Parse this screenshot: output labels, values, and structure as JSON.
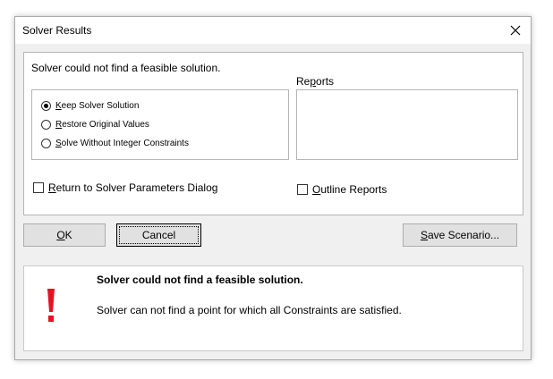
{
  "window": {
    "title": "Solver Results"
  },
  "group": {
    "message": "Solver could not find a feasible solution.",
    "options": [
      {
        "accel": "K",
        "rest": "eep Solver Solution",
        "checked": true
      },
      {
        "accel": "R",
        "rest": "estore Original Values",
        "checked": false
      },
      {
        "accel": "S",
        "rest": "olve Without Integer Constraints",
        "checked": false
      }
    ],
    "reports_label_pre": "Re",
    "reports_label_accel": "p",
    "reports_label_post": "orts",
    "return_accel": "R",
    "return_rest": "eturn to Solver Parameters Dialog",
    "outline_accel": "O",
    "outline_rest": "utline Reports"
  },
  "buttons": {
    "ok_accel": "O",
    "ok_rest": "K",
    "cancel": "Cancel",
    "save_accel": "S",
    "save_rest": "ave Scenario..."
  },
  "info": {
    "title": "Solver could not find a feasible solution.",
    "description": "Solver can not find a point for which all Constraints are satisfied.",
    "icon_color": "#e81123"
  }
}
